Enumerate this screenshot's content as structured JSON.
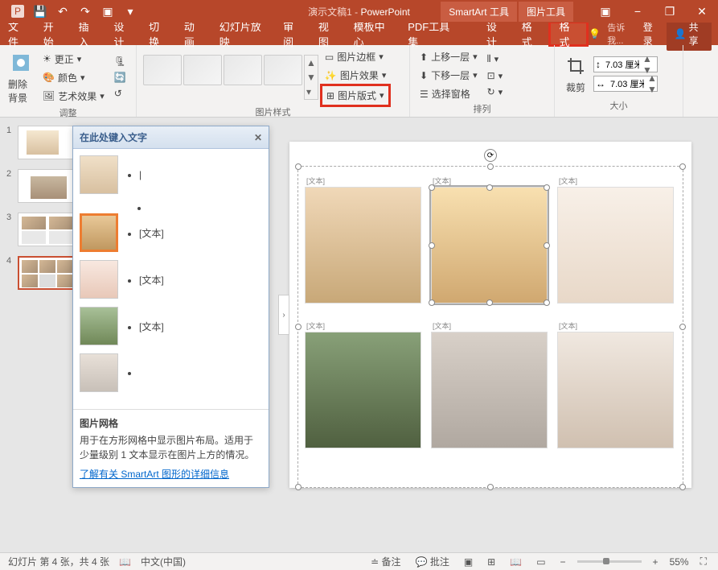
{
  "title": {
    "doc": "演示文稿1",
    "app": "PowerPoint"
  },
  "contextual_tabs": [
    "SmartArt 工具",
    "图片工具"
  ],
  "window_buttons": {
    "minimize": "−",
    "restore": "❐",
    "close": "✕"
  },
  "tabs": {
    "file": "文件",
    "home": "开始",
    "insert": "插入",
    "design": "设计",
    "transition": "切换",
    "animation": "动画",
    "slideshow": "幻灯片放映",
    "review": "审阅",
    "view": "视图",
    "template": "模板中心",
    "pdf": "PDF工具集",
    "sa_design": "设计",
    "sa_format": "格式",
    "pic_format": "格式"
  },
  "tabbar_right": {
    "tell_me": "告诉我...",
    "login": "登录",
    "share": "共享"
  },
  "ribbon": {
    "adjust": {
      "label": "调整",
      "remove_bg": "删除背景",
      "corrections": "更正",
      "color": "颜色",
      "artistic": "艺术效果"
    },
    "styles": {
      "label": "图片样式",
      "border": "图片边框",
      "effects": "图片效果",
      "layout": "图片版式"
    },
    "arrange": {
      "label": "排列",
      "bring_forward": "上移一层",
      "send_backward": "下移一层",
      "selection_pane": "选择窗格"
    },
    "size": {
      "label": "大小",
      "crop": "裁剪",
      "width": "7.03 厘米",
      "height": "7.03 厘米"
    }
  },
  "text_pane": {
    "title": "在此处键入文字",
    "items": [
      "",
      "",
      "[文本]",
      "[文本]",
      "[文本]",
      ""
    ],
    "footer_title": "图片网格",
    "footer_desc": "用于在方形网格中显示图片布局。适用于少量级别 1 文本显示在图片上方的情况。",
    "footer_link": "了解有关 SmartArt 图形的详细信息"
  },
  "slide": {
    "placeholder": "[文本]",
    "cells": [
      "[文本]",
      "[文本]",
      "[文本]",
      "[文本]",
      "[文本]",
      "[文本]"
    ]
  },
  "thumbnails": {
    "count": 4
  },
  "statusbar": {
    "slide_info": "幻灯片 第 4 张，共 4 张",
    "lang": "中文(中国)",
    "notes": "备注",
    "comments": "批注",
    "zoom": "55%"
  }
}
